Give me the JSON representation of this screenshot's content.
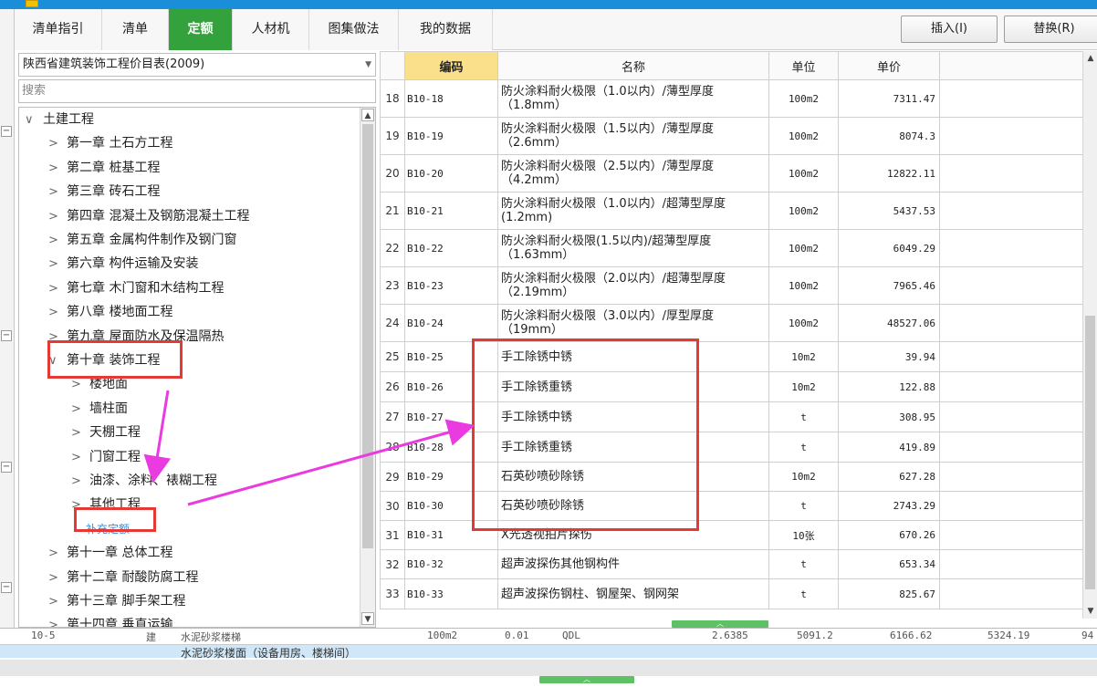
{
  "tabs": [
    {
      "label": "清单指引",
      "active": false
    },
    {
      "label": "清单",
      "active": false
    },
    {
      "label": "定额",
      "active": true
    },
    {
      "label": "人材机",
      "active": false
    },
    {
      "label": "图集做法",
      "active": false
    },
    {
      "label": "我的数据",
      "active": false
    }
  ],
  "buttons": {
    "insert": "插入(I)",
    "replace": "替换(R)"
  },
  "left": {
    "catalog_selected": "陕西省建筑装饰工程价目表(2009)",
    "search_placeholder": "搜索",
    "tree": [
      {
        "label": "土建工程",
        "arrow": "∨",
        "level": 0
      },
      {
        "label": "第一章 土石方工程",
        "arrow": ">",
        "level": 1
      },
      {
        "label": "第二章 桩基工程",
        "arrow": ">",
        "level": 1
      },
      {
        "label": "第三章 砖石工程",
        "arrow": ">",
        "level": 1
      },
      {
        "label": "第四章 混凝土及钢筋混凝土工程",
        "arrow": ">",
        "level": 1
      },
      {
        "label": "第五章 金属构件制作及钢门窗",
        "arrow": ">",
        "level": 1
      },
      {
        "label": "第六章 构件运输及安装",
        "arrow": ">",
        "level": 1
      },
      {
        "label": "第七章 木门窗和木结构工程",
        "arrow": ">",
        "level": 1
      },
      {
        "label": "第八章 楼地面工程",
        "arrow": ">",
        "level": 1
      },
      {
        "label": "第九章 屋面防水及保温隔热",
        "arrow": ">",
        "level": 1
      },
      {
        "label": "第十章 装饰工程",
        "arrow": "∨",
        "level": 1
      },
      {
        "label": "楼地面",
        "arrow": ">",
        "level": 2
      },
      {
        "label": "墙柱面",
        "arrow": ">",
        "level": 2
      },
      {
        "label": "天棚工程",
        "arrow": ">",
        "level": 2
      },
      {
        "label": "门窗工程",
        "arrow": ">",
        "level": 2
      },
      {
        "label": "油漆、涂料、裱糊工程",
        "arrow": ">",
        "level": 2
      },
      {
        "label": "其他工程",
        "arrow": ">",
        "level": 2
      },
      {
        "label": "补充定额",
        "arrow": "",
        "level": 2,
        "link": true
      },
      {
        "label": "第十一章 总体工程",
        "arrow": ">",
        "level": 1
      },
      {
        "label": "第十二章 耐酸防腐工程",
        "arrow": ">",
        "level": 1
      },
      {
        "label": "第十三章 脚手架工程",
        "arrow": ">",
        "level": 1
      },
      {
        "label": "第十四章 垂直运输",
        "arrow": ">",
        "level": 1
      }
    ]
  },
  "table": {
    "headers": {
      "code": "编码",
      "name": "名称",
      "unit": "单位",
      "price": "单价"
    },
    "rows": [
      {
        "no": "18",
        "code": "B10-18",
        "name": "防火涂料耐火极限（1.0以内）/薄型厚度（1.8mm）",
        "unit": "100m2",
        "price": "7311.47"
      },
      {
        "no": "19",
        "code": "B10-19",
        "name": "防火涂料耐火极限（1.5以内）/薄型厚度（2.6mm）",
        "unit": "100m2",
        "price": "8074.3"
      },
      {
        "no": "20",
        "code": "B10-20",
        "name": "防火涂料耐火极限（2.5以内）/薄型厚度（4.2mm）",
        "unit": "100m2",
        "price": "12822.11"
      },
      {
        "no": "21",
        "code": "B10-21",
        "name": "防火涂料耐火极限（1.0以内）/超薄型厚度(1.2mm)",
        "unit": "100m2",
        "price": "5437.53"
      },
      {
        "no": "22",
        "code": "B10-22",
        "name": "防火涂料耐火极限(1.5以内)/超薄型厚度（1.63mm）",
        "unit": "100m2",
        "price": "6049.29"
      },
      {
        "no": "23",
        "code": "B10-23",
        "name": "防火涂料耐火极限（2.0以内）/超薄型厚度（2.19mm）",
        "unit": "100m2",
        "price": "7965.46"
      },
      {
        "no": "24",
        "code": "B10-24",
        "name": "防火涂料耐火极限（3.0以内）/厚型厚度（19mm）",
        "unit": "100m2",
        "price": "48527.06"
      },
      {
        "no": "25",
        "code": "B10-25",
        "name": "手工除锈中锈",
        "unit": "10m2",
        "price": "39.94"
      },
      {
        "no": "26",
        "code": "B10-26",
        "name": "手工除锈重锈",
        "unit": "10m2",
        "price": "122.88"
      },
      {
        "no": "27",
        "code": "B10-27",
        "name": "手工除锈中锈",
        "unit": "t",
        "price": "308.95"
      },
      {
        "no": "28",
        "code": "B10-28",
        "name": "手工除锈重锈",
        "unit": "t",
        "price": "419.89"
      },
      {
        "no": "29",
        "code": "B10-29",
        "name": "石英砂喷砂除锈",
        "unit": "10m2",
        "price": "627.28"
      },
      {
        "no": "30",
        "code": "B10-30",
        "name": "石英砂喷砂除锈",
        "unit": "t",
        "price": "2743.29"
      },
      {
        "no": "31",
        "code": "B10-31",
        "name": "X光透视拍片探伤",
        "unit": "10张",
        "price": "670.26"
      },
      {
        "no": "32",
        "code": "B10-32",
        "name": "超声波探伤其他钢构件",
        "unit": "t",
        "price": "653.34"
      },
      {
        "no": "33",
        "code": "B10-33",
        "name": "超声波探伤钢柱、钢屋架、钢网架",
        "unit": "t",
        "price": "825.67"
      }
    ]
  },
  "bottom": {
    "row1": [
      "10-5",
      "建",
      "水泥砂浆楼梯",
      "100m2",
      "0.01",
      "QDL",
      "2.6385",
      "5091.2",
      "6166.62",
      "5324.19",
      "94"
    ],
    "row2_text": "水泥砂浆楼面（设备用房、楼梯间）"
  },
  "colors": {
    "active_tab": "#33a23c",
    "highlight": "#e53935",
    "arrow": "#e93be0",
    "code_header": "#fbe08c"
  }
}
